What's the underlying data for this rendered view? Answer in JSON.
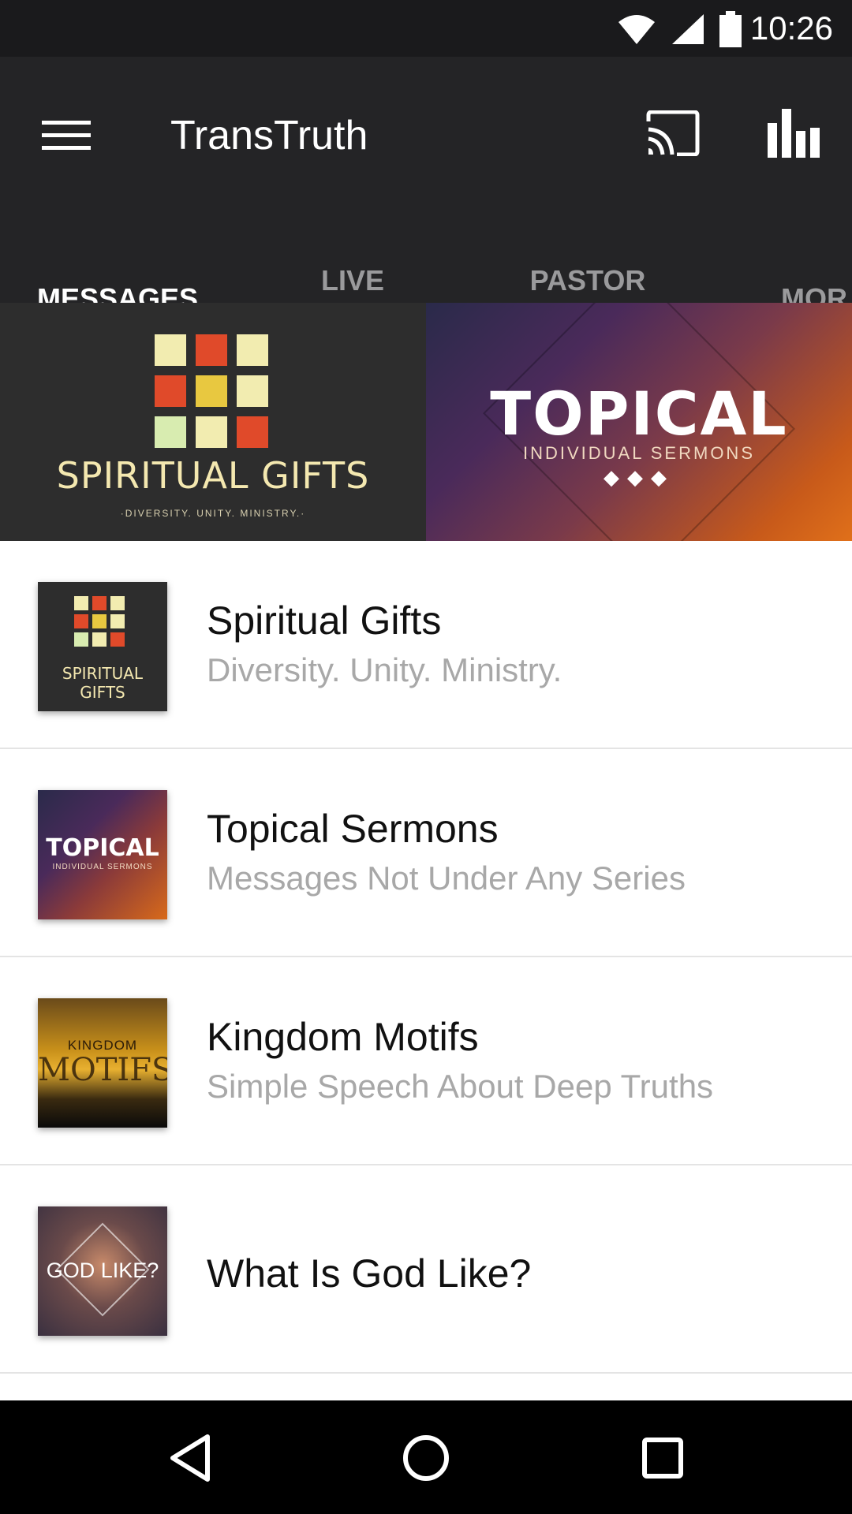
{
  "status_bar": {
    "time": "10:26",
    "icons": [
      "wifi-icon",
      "signal-icon",
      "battery-icon"
    ]
  },
  "app_bar": {
    "title": "TransTruth",
    "icons": [
      "menu-icon",
      "cast-icon",
      "bar-chart-icon"
    ]
  },
  "tabs": [
    {
      "label": "MESSAGES",
      "active": true
    },
    {
      "label": "LIVE SERVICES",
      "active": false
    },
    {
      "label": "PASTOR JEFF",
      "active": false
    },
    {
      "label": "MOR",
      "active": false
    }
  ],
  "hero": {
    "left": {
      "title": "SPIRITUAL GIFTS",
      "subtitle": "·DIVERSITY. UNITY. MINISTRY.·"
    },
    "right": {
      "title": "TOPICAL",
      "subtitle": "INDIVIDUAL SERMONS",
      "dots": "◆◆◆"
    }
  },
  "series": [
    {
      "title": "Spiritual Gifts",
      "subtitle": "Diversity. Unity. Ministry.",
      "thumb_text": "SPIRITUAL GIFTS"
    },
    {
      "title": "Topical Sermons",
      "subtitle": "Messages Not Under Any Series",
      "thumb_text": "TOPICAL",
      "thumb_sub": "INDIVIDUAL SERMONS"
    },
    {
      "title": "Kingdom Motifs",
      "subtitle": "Simple Speech About Deep Truths",
      "thumb_text": "KINGDOM",
      "thumb_text2": "MOTIFS"
    },
    {
      "title": "What Is God Like?",
      "subtitle": "",
      "thumb_text": "GOD LIKE?"
    }
  ],
  "nav_bar": {
    "icons": [
      "back-icon",
      "home-icon",
      "recents-icon"
    ]
  },
  "colors": {
    "app_bar": "#242426",
    "status_bar": "#1a1a1c",
    "active_tab": "#ffffff",
    "inactive_tab": "#9a9a9c",
    "subtitle": "#a8a8a8"
  }
}
